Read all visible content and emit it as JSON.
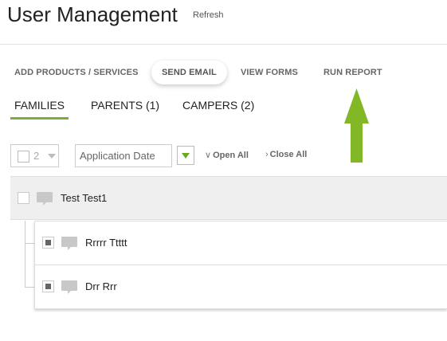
{
  "header": {
    "title": "User Management",
    "refresh_label": "Refresh"
  },
  "actions": [
    {
      "label": "ADD PRODUCTS / SERVICES"
    },
    {
      "label": "SEND EMAIL"
    },
    {
      "label": "VIEW FORMS"
    },
    {
      "label": "RUN REPORT"
    }
  ],
  "tabs": [
    {
      "label": "FAMILIES"
    },
    {
      "label": "PARENTS (1)"
    },
    {
      "label": "CAMPERS (2)"
    }
  ],
  "filters": {
    "selected_count": "2",
    "sort_value": "Application Date",
    "open_all_label": "Open All",
    "close_all_label": "Close All"
  },
  "family": {
    "name": "Test Test1",
    "members": [
      {
        "name": "Rrrrr Ttttt"
      },
      {
        "name": "Drr Rrr"
      }
    ]
  },
  "icons": {
    "chat": "chat-bubble-icon",
    "arrow": "up-arrow-icon",
    "expand": "chevron-down-icon",
    "collapse": "chevron-right-icon"
  },
  "colors": {
    "accent": "#7ab02b",
    "arrow": "#82b825",
    "row_bg": "#efefef"
  }
}
